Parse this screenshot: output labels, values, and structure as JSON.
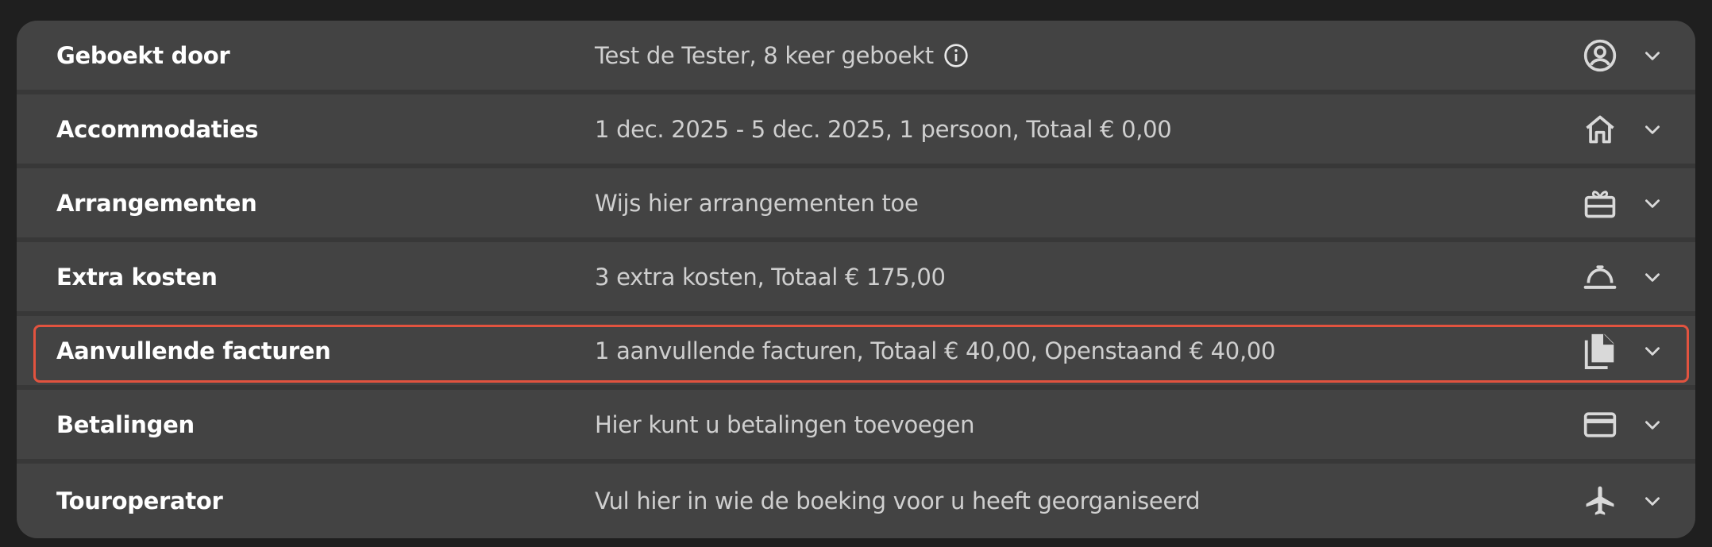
{
  "rows": [
    {
      "label": "Geboekt door",
      "summary": "Test de Tester, 8 keer geboekt",
      "icon": "user-circle-icon",
      "has_info": true
    },
    {
      "label": "Accommodaties",
      "summary": "1 dec. 2025 - 5 dec. 2025, 1 persoon, Totaal € 0,00",
      "icon": "home-icon"
    },
    {
      "label": "Arrangementen",
      "summary": "Wijs hier arrangementen toe",
      "icon": "gift-box-icon"
    },
    {
      "label": "Extra kosten",
      "summary": "3 extra kosten, Totaal € 175,00",
      "icon": "room-service-bell-icon"
    },
    {
      "label": "Aanvullende facturen",
      "summary": "1 aanvullende facturen, Totaal € 40,00, Openstaand € 40,00",
      "icon": "documents-icon",
      "selected": true
    },
    {
      "label": "Betalingen",
      "summary": "Hier kunt u betalingen toevoegen",
      "icon": "credit-card-icon"
    },
    {
      "label": "Touroperator",
      "summary": "Vul hier in wie de boeking voor u heeft georganiseerd",
      "icon": "airplane-icon"
    }
  ],
  "colors": {
    "page_bg": "#1f1f1f",
    "panel_bg": "#383838",
    "row_bg": "#434343",
    "label": "#ffffff",
    "summary": "#cfcfcf",
    "icon": "#d9d9d9",
    "highlight": "#e2533f"
  }
}
